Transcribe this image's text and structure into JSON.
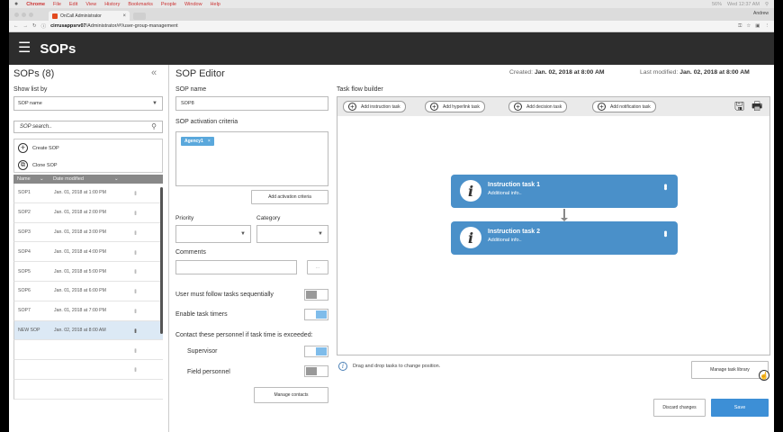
{
  "mac_menubar": {
    "app": "Chrome",
    "menus": [
      "File",
      "Edit",
      "View",
      "History",
      "Bookmarks",
      "People",
      "Window",
      "Help"
    ],
    "clock": "Wed 12:37 AM",
    "battery": "56%"
  },
  "browser": {
    "tab_title": "OnCall Administrator",
    "profile": "Andrew",
    "url_host": "cirrusappsrv07",
    "url_path": "/Administrator/#!/user-group-management"
  },
  "app_header": {
    "title": "SOPs"
  },
  "left_panel": {
    "title": "SOPs (8)",
    "collapse_icon": "«",
    "show_list_by_label": "Show list by",
    "show_list_by_value": "SOP name",
    "search_placeholder": "SOP search..",
    "actions": [
      {
        "label": "Create SOP",
        "icon": "plus-circle-icon"
      },
      {
        "label": "Clone SOP",
        "icon": "clone-icon"
      }
    ],
    "columns": [
      "Name",
      "Date modified"
    ],
    "rows": [
      {
        "name": "SOP1",
        "date": "Jan. 01, 2018 at 1:00 PM"
      },
      {
        "name": "SOP2",
        "date": "Jan. 01, 2018 at 2:00 PM"
      },
      {
        "name": "SOP3",
        "date": "Jan. 01, 2018 at 3:00 PM"
      },
      {
        "name": "SOP4",
        "date": "Jan. 01, 2018 at 4:00 PM"
      },
      {
        "name": "SOP5",
        "date": "Jan. 01, 2018 at 5:00 PM"
      },
      {
        "name": "SOP6",
        "date": "Jan. 01, 2018 at 6:00 PM"
      },
      {
        "name": "SOP7",
        "date": "Jan. 01, 2018 at 7:00 PM"
      },
      {
        "name": "NEW SOP",
        "date": "Jan. 02, 2018 at 8:00 AM"
      }
    ]
  },
  "editor": {
    "title": "SOP Editor",
    "sop_name_label": "SOP name",
    "sop_name_value": "SOP8",
    "activation_label": "SOP activation criteria",
    "activation_chip": "Agency1",
    "add_activation_button": "Add activation criteria",
    "priority_label": "Priority",
    "category_label": "Category",
    "comments_label": "Comments",
    "comments_more": "...",
    "sequential_label": "User must follow tasks sequentially",
    "sequential_on": false,
    "timers_label": "Enable task timers",
    "timers_on": true,
    "contact_label": "Contact these personnel if task time is exceeded:",
    "supervisor_label": "Supervisor",
    "supervisor_on": true,
    "field_personnel_label": "Field personnel",
    "field_personnel_on": false,
    "manage_contacts_button": "Manage contacts"
  },
  "meta": {
    "created_label": "Created:",
    "created_value": "Jan. 02, 2018 at 8:00 AM",
    "modified_label": "Last modified:",
    "modified_value": "Jan. 02, 2018 at 8:00 AM"
  },
  "flow": {
    "label": "Task flow builder",
    "toolbar": [
      "Add instruction task",
      "Add hyperlink task",
      "Add decision task",
      "Add notification task"
    ],
    "tasks": [
      {
        "title": "Instruction task 1",
        "subtitle": "Additional info.."
      },
      {
        "title": "Instruction task 2",
        "subtitle": "Additional info.."
      }
    ],
    "hint": "Drag and drop tasks to change position.",
    "manage_library_button": "Manage task library",
    "discard_button": "Discard changes",
    "save_button": "Save",
    "task_color": "#4a90c9",
    "save_color": "#3d8fd6"
  }
}
